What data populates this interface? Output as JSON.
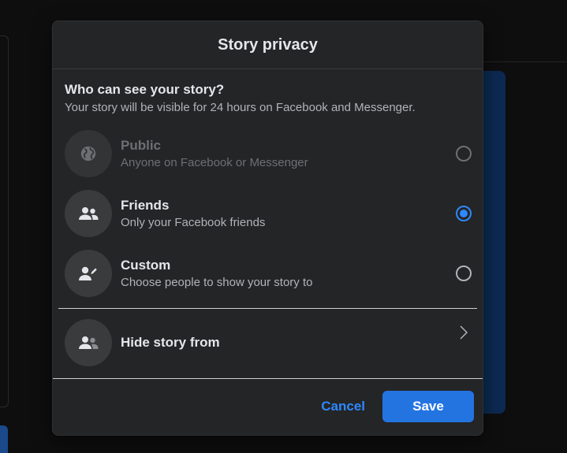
{
  "dialog": {
    "title": "Story privacy",
    "intro_heading": "Who can see your story?",
    "intro_desc": "Your story will be visible for 24 hours on Facebook and Messenger."
  },
  "options": [
    {
      "label": "Public",
      "sub": "Anyone on Facebook or Messenger",
      "icon": "globe-icon",
      "selected": false,
      "disabled": true
    },
    {
      "label": "Friends",
      "sub": "Only your Facebook friends",
      "icon": "friends-icon",
      "selected": true,
      "disabled": false
    },
    {
      "label": "Custom",
      "sub": "Choose people to show your story to",
      "icon": "custom-person-icon",
      "selected": false,
      "disabled": false
    }
  ],
  "hide": {
    "label": "Hide story from",
    "icon": "hide-from-people-icon"
  },
  "footer": {
    "cancel_label": "Cancel",
    "save_label": "Save"
  },
  "colors": {
    "accent": "#2d88ff",
    "save_bg": "#2374e1",
    "dialog_bg": "#242526"
  }
}
